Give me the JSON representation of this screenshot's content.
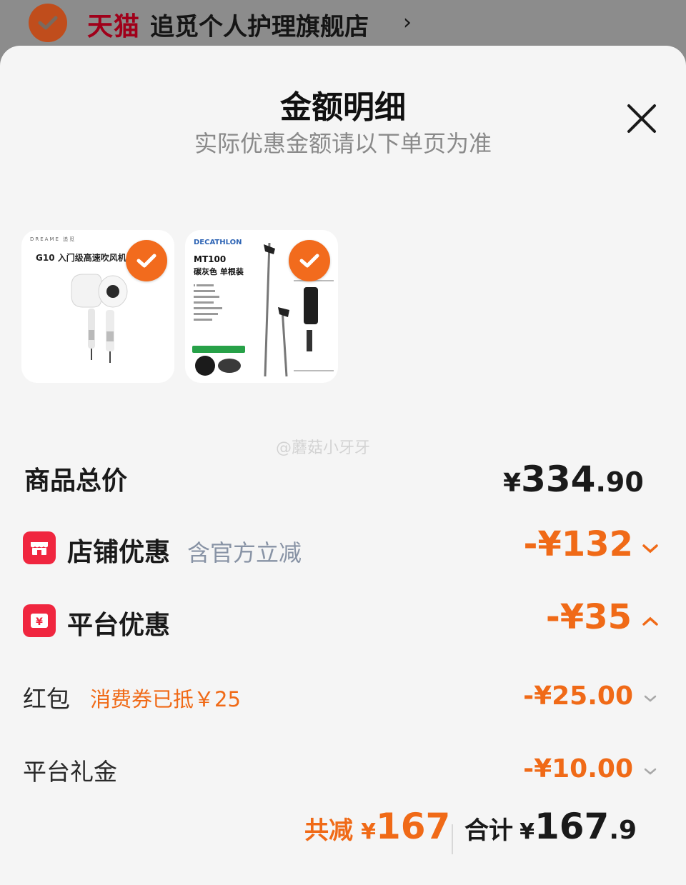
{
  "store": {
    "platform_logo": "天猫",
    "name": "追觅个人护理旗舰店",
    "chevron": "›"
  },
  "sheet": {
    "title": "金额明细",
    "subtitle": "实际优惠金额请以下单页为准",
    "close_icon": "close-icon"
  },
  "products": [
    {
      "brand": "DREAME 追觅",
      "caption": "G10 入门级高速吹风机",
      "selected": true
    },
    {
      "brand": "DECATHLON",
      "model": "MT100",
      "name": "碳灰色 单根装",
      "selected": true
    }
  ],
  "watermark": "@蘑菇小牙牙",
  "total": {
    "label": "商品总价",
    "currency": "¥",
    "integer": "334",
    "decimal": ".90"
  },
  "store_discount": {
    "label": "店铺优惠",
    "note": "含官方立减",
    "value": "-¥132",
    "expanded": false
  },
  "platform_discount": {
    "label": "平台优惠",
    "value": "-¥35",
    "expanded": true,
    "items": [
      {
        "label": "红包",
        "note": "消费券已抵￥25",
        "value": "-¥25.00"
      },
      {
        "label": "平台礼金",
        "note": "",
        "value": "-¥10.00"
      }
    ]
  },
  "summary": {
    "reduced_label": "共减",
    "reduced_currency": "¥",
    "reduced_value": "167",
    "total_label": "合计",
    "total_currency": "¥",
    "total_integer": "167",
    "total_decimal": ".9"
  },
  "colors": {
    "accent_orange": "#f06a17",
    "badge_red": "#f0263f",
    "check_orange": "#f26b1d",
    "tmall_red": "#a0001a"
  }
}
